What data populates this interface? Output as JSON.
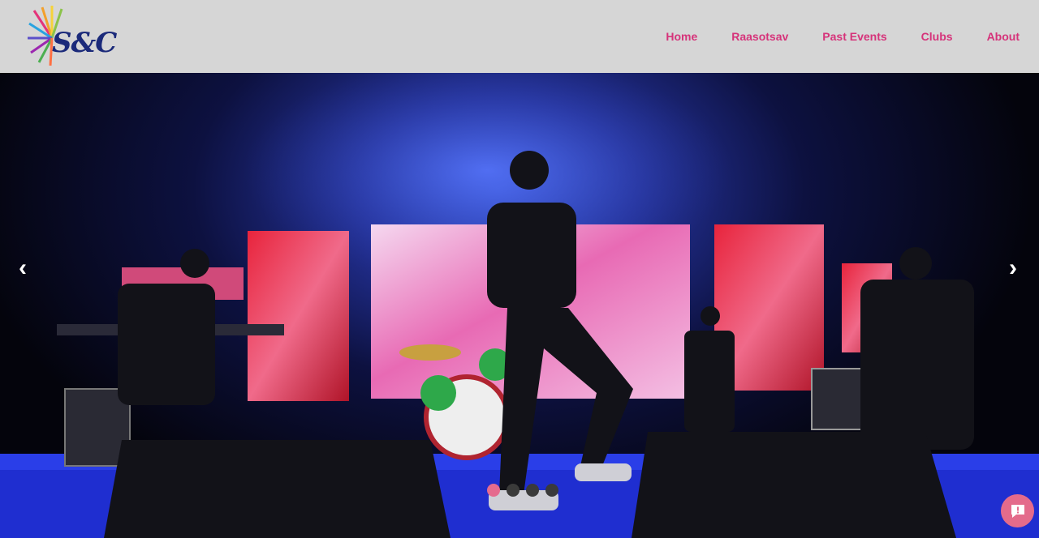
{
  "brand": {
    "logo_text": "S&C"
  },
  "nav": {
    "items": [
      {
        "label": "Home"
      },
      {
        "label": "Raasotsav"
      },
      {
        "label": "Past Events"
      },
      {
        "label": "Clubs"
      },
      {
        "label": "About"
      }
    ]
  },
  "carousel": {
    "prev_icon": "chevron-left-icon",
    "next_icon": "chevron-right-icon",
    "prev_glyph": "‹",
    "next_glyph": "›",
    "slide_count": 4,
    "active_index": 0,
    "slide_image": "concert-stage-photo",
    "colors": {
      "active_dot": "#e56b8e",
      "inactive_dot": "#3a3a3a"
    }
  },
  "chat": {
    "icon": "chat-bubble-icon"
  },
  "colors": {
    "nav_link": "#d6337a",
    "nav_bg": "#d6d6d6",
    "chat_bg": "#e46b8b"
  }
}
